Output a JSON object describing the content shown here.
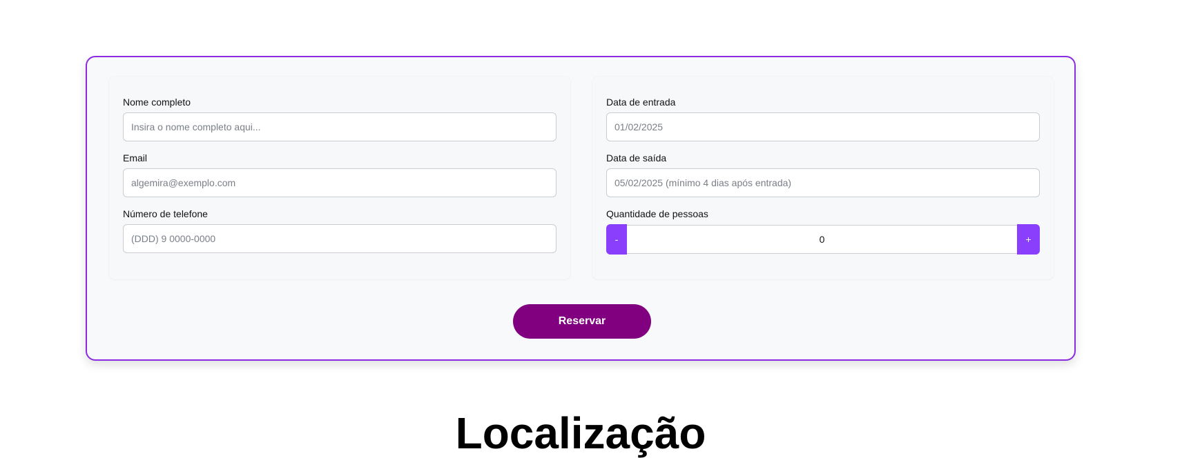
{
  "form": {
    "full_name": {
      "label": "Nome completo",
      "placeholder": "Insira o nome completo aqui..."
    },
    "email": {
      "label": "Email",
      "placeholder": "algemira@exemplo.com"
    },
    "phone": {
      "label": "Número de telefone",
      "placeholder": "(DDD) 9 0000-0000"
    },
    "check_in": {
      "label": "Data de entrada",
      "placeholder": "01/02/2025"
    },
    "check_out": {
      "label": "Data de saída",
      "placeholder": "05/02/2025 (mínimo 4 dias após entrada)"
    },
    "guests": {
      "label": "Quantidade de pessoas",
      "decrement_label": "-",
      "increment_label": "+",
      "value": "0"
    },
    "submit_label": "Reservar"
  },
  "location_section": {
    "title": "Localização"
  },
  "colors": {
    "card_border": "#8a2be2",
    "stepper_accent": "#8a3ffc",
    "submit_button": "#800080"
  }
}
